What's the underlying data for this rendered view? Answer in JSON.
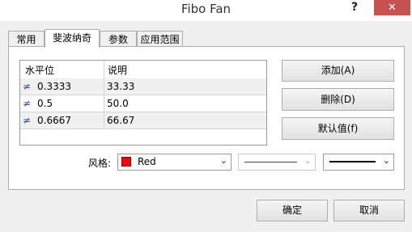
{
  "window": {
    "title": "Fibo Fan",
    "help": "?",
    "close": "✕"
  },
  "tabs": [
    "常用",
    "斐波纳奇",
    "参数",
    "应用范围"
  ],
  "levels": {
    "headers": [
      "水平位",
      "说明"
    ],
    "icon": "≠",
    "rows": [
      {
        "level": "0.3333",
        "desc": "33.33"
      },
      {
        "level": "0.5",
        "desc": "50.0"
      },
      {
        "level": "0.6667",
        "desc": "66.67"
      }
    ]
  },
  "buttons": {
    "add": "添加(A)",
    "delete": "删除(D)",
    "default": "默认值(f)"
  },
  "style": {
    "label": "风格:",
    "color_value": "Red",
    "color_hex": "#ff0000",
    "line_style": "solid",
    "line_width": "medium"
  },
  "footer": {
    "ok": "确定",
    "cancel": "取消"
  },
  "icons": {
    "dropdown": "chevron-down-icon"
  }
}
